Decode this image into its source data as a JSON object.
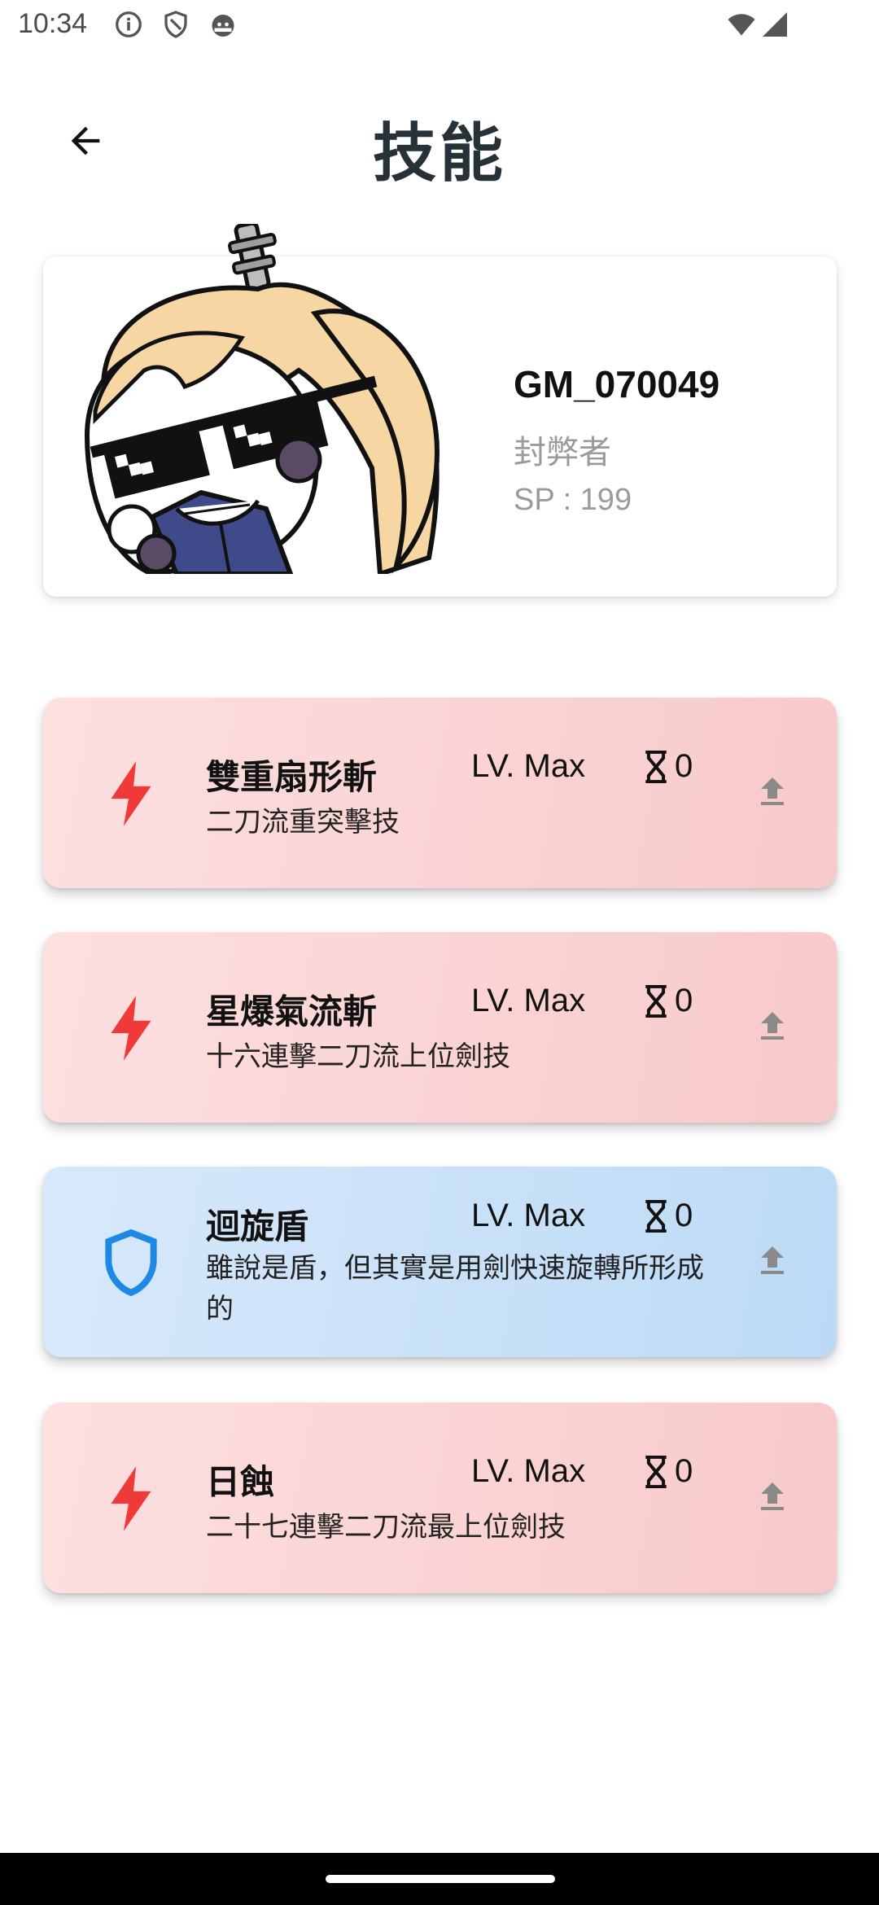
{
  "status_bar": {
    "time": "10:34",
    "icons_left": [
      "info-icon",
      "shield-icon",
      "android-icon"
    ],
    "icons_right": [
      "wifi-icon",
      "signal-icon"
    ]
  },
  "header": {
    "back_icon": "arrow-back-icon",
    "title": "技能"
  },
  "profile": {
    "name": "GM_070049",
    "role": "封弊者",
    "sp": "SP : 199",
    "avatar": "chibi character with pixel sunglasses"
  },
  "skills": [
    {
      "type": "attack",
      "icon": "bolt-icon",
      "name": "雙重扇形斬",
      "level": "LV. Max",
      "cooldown": "0",
      "description": "二刀流重突擊技"
    },
    {
      "type": "attack",
      "icon": "bolt-icon",
      "name": "星爆氣流斬",
      "level": "LV. Max",
      "cooldown": "0",
      "description": "十六連擊二刀流上位劍技"
    },
    {
      "type": "defense",
      "icon": "shield-icon",
      "name": "迴旋盾",
      "level": "LV. Max",
      "cooldown": "0",
      "description": "雖說是盾，但其實是用劍快速旋轉所形成的"
    },
    {
      "type": "attack",
      "icon": "bolt-icon",
      "name": "日蝕",
      "level": "LV. Max",
      "cooldown": "0",
      "description": "二十七連擊二刀流最上位劍技"
    }
  ],
  "colors": {
    "attack_card": "#f8c9c9",
    "defense_card": "#bcdaf6",
    "bolt": "#f03a3a",
    "shield": "#1e88e5",
    "title": "#263238"
  }
}
